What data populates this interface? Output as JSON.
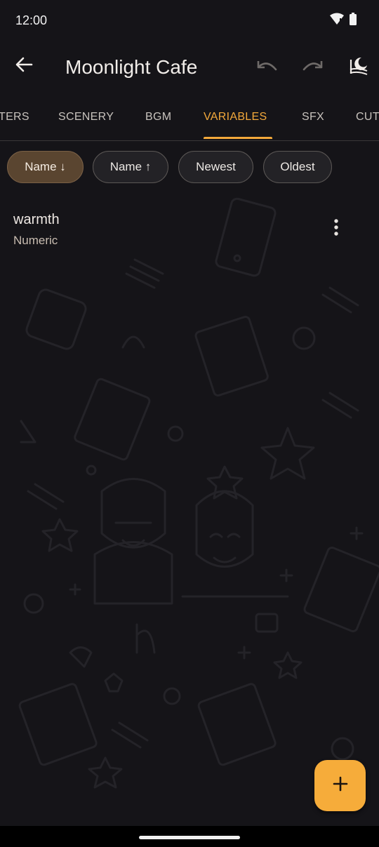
{
  "status_bar": {
    "time": "12:00",
    "icons": [
      "wifi-icon",
      "battery-icon"
    ]
  },
  "app_bar": {
    "title": "Moonlight Cafe",
    "icons": [
      "back-arrow-icon",
      "undo-icon",
      "redo-icon",
      "theme-icon"
    ]
  },
  "tabs": {
    "items": [
      {
        "label": "TERS"
      },
      {
        "label": "SCENERY"
      },
      {
        "label": "BGM"
      },
      {
        "label": "VARIABLES"
      },
      {
        "label": "SFX"
      },
      {
        "label": "CUT"
      }
    ],
    "active": "VARIABLES"
  },
  "sort_chips": {
    "items": [
      {
        "label": "Name ↓",
        "selected": true
      },
      {
        "label": "Name ↑",
        "selected": false
      },
      {
        "label": "Newest",
        "selected": false
      },
      {
        "label": "Oldest",
        "selected": false
      }
    ]
  },
  "variables": [
    {
      "name": "warmth",
      "type": "Numeric"
    }
  ],
  "fab": {
    "icon": "plus-icon"
  },
  "colors": {
    "accent": "#f3a93b",
    "background": "#151418",
    "chip_selected": "#5a4530",
    "fab": "#f6ac3a"
  }
}
